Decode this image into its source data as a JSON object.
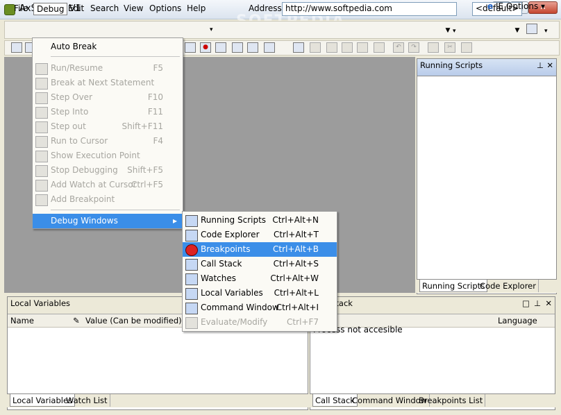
{
  "window": {
    "title": "AxScripter V1",
    "watermark": "SOFTPEDIA"
  },
  "menubar": {
    "items": [
      "File",
      "Debug",
      "Edit",
      "Search",
      "View",
      "Options",
      "Help"
    ]
  },
  "address": {
    "label": "Address",
    "value": "http://www.softpedia.com"
  },
  "profile_combo": {
    "value": "<default>"
  },
  "toolbar": {
    "ie_options_label": "IE Options"
  },
  "running_scripts_pane": {
    "title": "Running Scripts",
    "tabs": [
      "Running Scripts",
      "Code Explorer"
    ]
  },
  "local_variables_pane": {
    "title": "Local Variables",
    "columns": [
      "Name",
      "Value (Can be modified)"
    ],
    "tabs": [
      "Local Variables",
      "Watch List"
    ]
  },
  "call_stack_pane": {
    "title": "Call Stack",
    "columns": [
      "",
      "Language"
    ],
    "message": "Process not accesible",
    "tabs": [
      "Call Stack",
      "Command Window",
      "Breakpoints List"
    ]
  },
  "debug_menu": {
    "items": [
      {
        "label": "Auto Break",
        "shortcut": "",
        "disabled": false
      },
      {
        "label": "Run/Resume",
        "shortcut": "F5",
        "disabled": true
      },
      {
        "label": "Break at Next Statement",
        "shortcut": "",
        "disabled": true
      },
      {
        "label": "Step Over",
        "shortcut": "F10",
        "disabled": true
      },
      {
        "label": "Step Into",
        "shortcut": "F11",
        "disabled": true
      },
      {
        "label": "Step out",
        "shortcut": "Shift+F11",
        "disabled": true
      },
      {
        "label": "Run to Cursor",
        "shortcut": "F4",
        "disabled": true
      },
      {
        "label": "Show Execution Point",
        "shortcut": "",
        "disabled": true
      },
      {
        "label": "Stop Debugging",
        "shortcut": "Shift+F5",
        "disabled": true
      },
      {
        "label": "Add Watch at Cursor",
        "shortcut": "Ctrl+F5",
        "disabled": true
      },
      {
        "label": "Add Breakpoint",
        "shortcut": "",
        "disabled": true
      },
      {
        "label": "Debug Windows",
        "shortcut": "",
        "disabled": false
      }
    ]
  },
  "debug_windows_submenu": {
    "items": [
      {
        "label": "Running Scripts",
        "shortcut": "Ctrl+Alt+N",
        "icon": "running-scripts-icon"
      },
      {
        "label": "Code Explorer",
        "shortcut": "Ctrl+Alt+T",
        "icon": "code-explorer-icon"
      },
      {
        "label": "Breakpoints",
        "shortcut": "Ctrl+Alt+B",
        "icon": "breakpoint-icon"
      },
      {
        "label": "Call Stack",
        "shortcut": "Ctrl+Alt+S",
        "icon": "call-stack-icon"
      },
      {
        "label": "Watches",
        "shortcut": "Ctrl+Alt+W",
        "icon": "watches-icon"
      },
      {
        "label": "Local Variables",
        "shortcut": "Ctrl+Alt+L",
        "icon": "local-variables-icon"
      },
      {
        "label": "Command Window",
        "shortcut": "Ctrl+Alt+I",
        "icon": "command-window-icon"
      },
      {
        "label": "Evaluate/Modify",
        "shortcut": "Ctrl+F7",
        "icon": "evaluate-icon"
      }
    ]
  },
  "colors": {
    "highlight": "#3b8ee8",
    "workspace": "#9c9c9c"
  }
}
